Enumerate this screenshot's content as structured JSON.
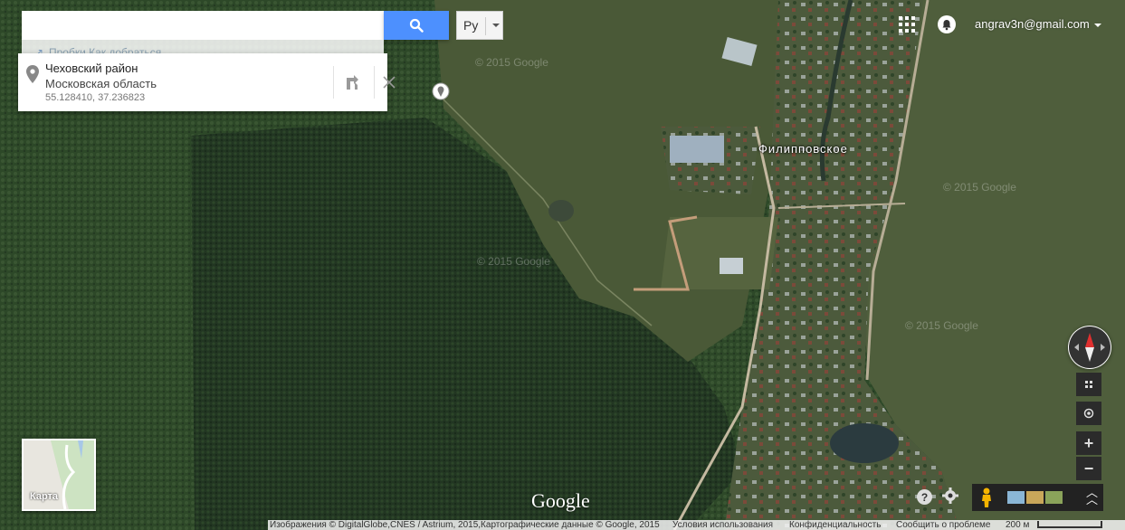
{
  "search": {
    "value": "",
    "placeholder": ""
  },
  "language": {
    "label": "Ру"
  },
  "subbar": {
    "text": "Пробки  Как добраться"
  },
  "card": {
    "title": "Чеховский район",
    "region": "Московская область",
    "coords": "55.128410, 37.236823"
  },
  "account": {
    "email": "angrav3n@gmail.com"
  },
  "map": {
    "place_label": "Филипповское",
    "watermarks": [
      "© 2015 Google",
      "© 2015 Google",
      "© 2015 Google",
      "© 2015 Google",
      "© 2015 Google"
    ],
    "minimap_label": "Карта",
    "logo": "Google"
  },
  "controls": {
    "zoom_in": "+",
    "zoom_out": "−",
    "help": "?"
  },
  "footer": {
    "imagery": "Изображения © DigitalGlobe,CNES / Astrium, 2015,Картографические данные © Google, 2015",
    "terms": "Условия использования",
    "privacy": "Конфиденциальность",
    "report": "Сообщить о проблеме",
    "scale": "200 м"
  },
  "colors": {
    "search_button": "#4d90fe",
    "forest": "#1f3320",
    "field": "#4d5d3a"
  }
}
